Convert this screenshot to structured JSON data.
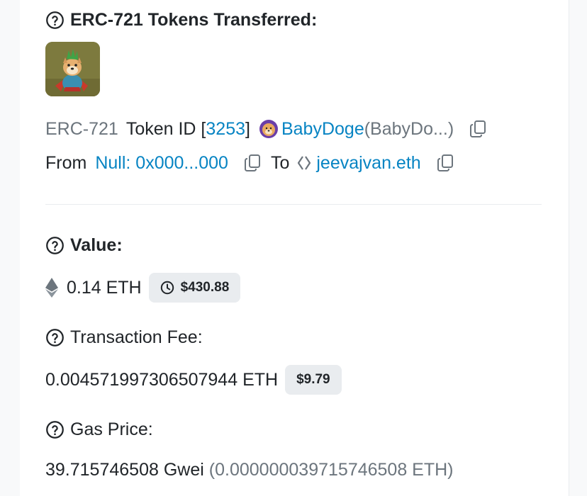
{
  "nft_section": {
    "title": "ERC-721 Tokens Transferred:",
    "standard": "ERC-721",
    "token_id_label": "Token ID [",
    "token_id": "3253",
    "token_id_close": "]",
    "collection_name": "BabyDoge",
    "collection_symbol": "(BabyDo...)",
    "from_label": "From",
    "from_address": "Null: 0x000...000",
    "to_label": "To",
    "to_address": "jeevajvan.eth"
  },
  "value_section": {
    "title": "Value:",
    "amount": "0.14 ETH",
    "usd": "$430.88"
  },
  "fee_section": {
    "title": "Transaction Fee:",
    "amount": "0.004571997306507944 ETH",
    "usd": "$9.79"
  },
  "gas_section": {
    "title": "Gas Price:",
    "gwei": "39.715746508 Gwei",
    "eth": "(0.000000039715746508 ETH)"
  },
  "colors": {
    "link": "#0784c3",
    "text": "#212529",
    "muted": "#6c757d",
    "pill_bg": "#e9ecef"
  }
}
